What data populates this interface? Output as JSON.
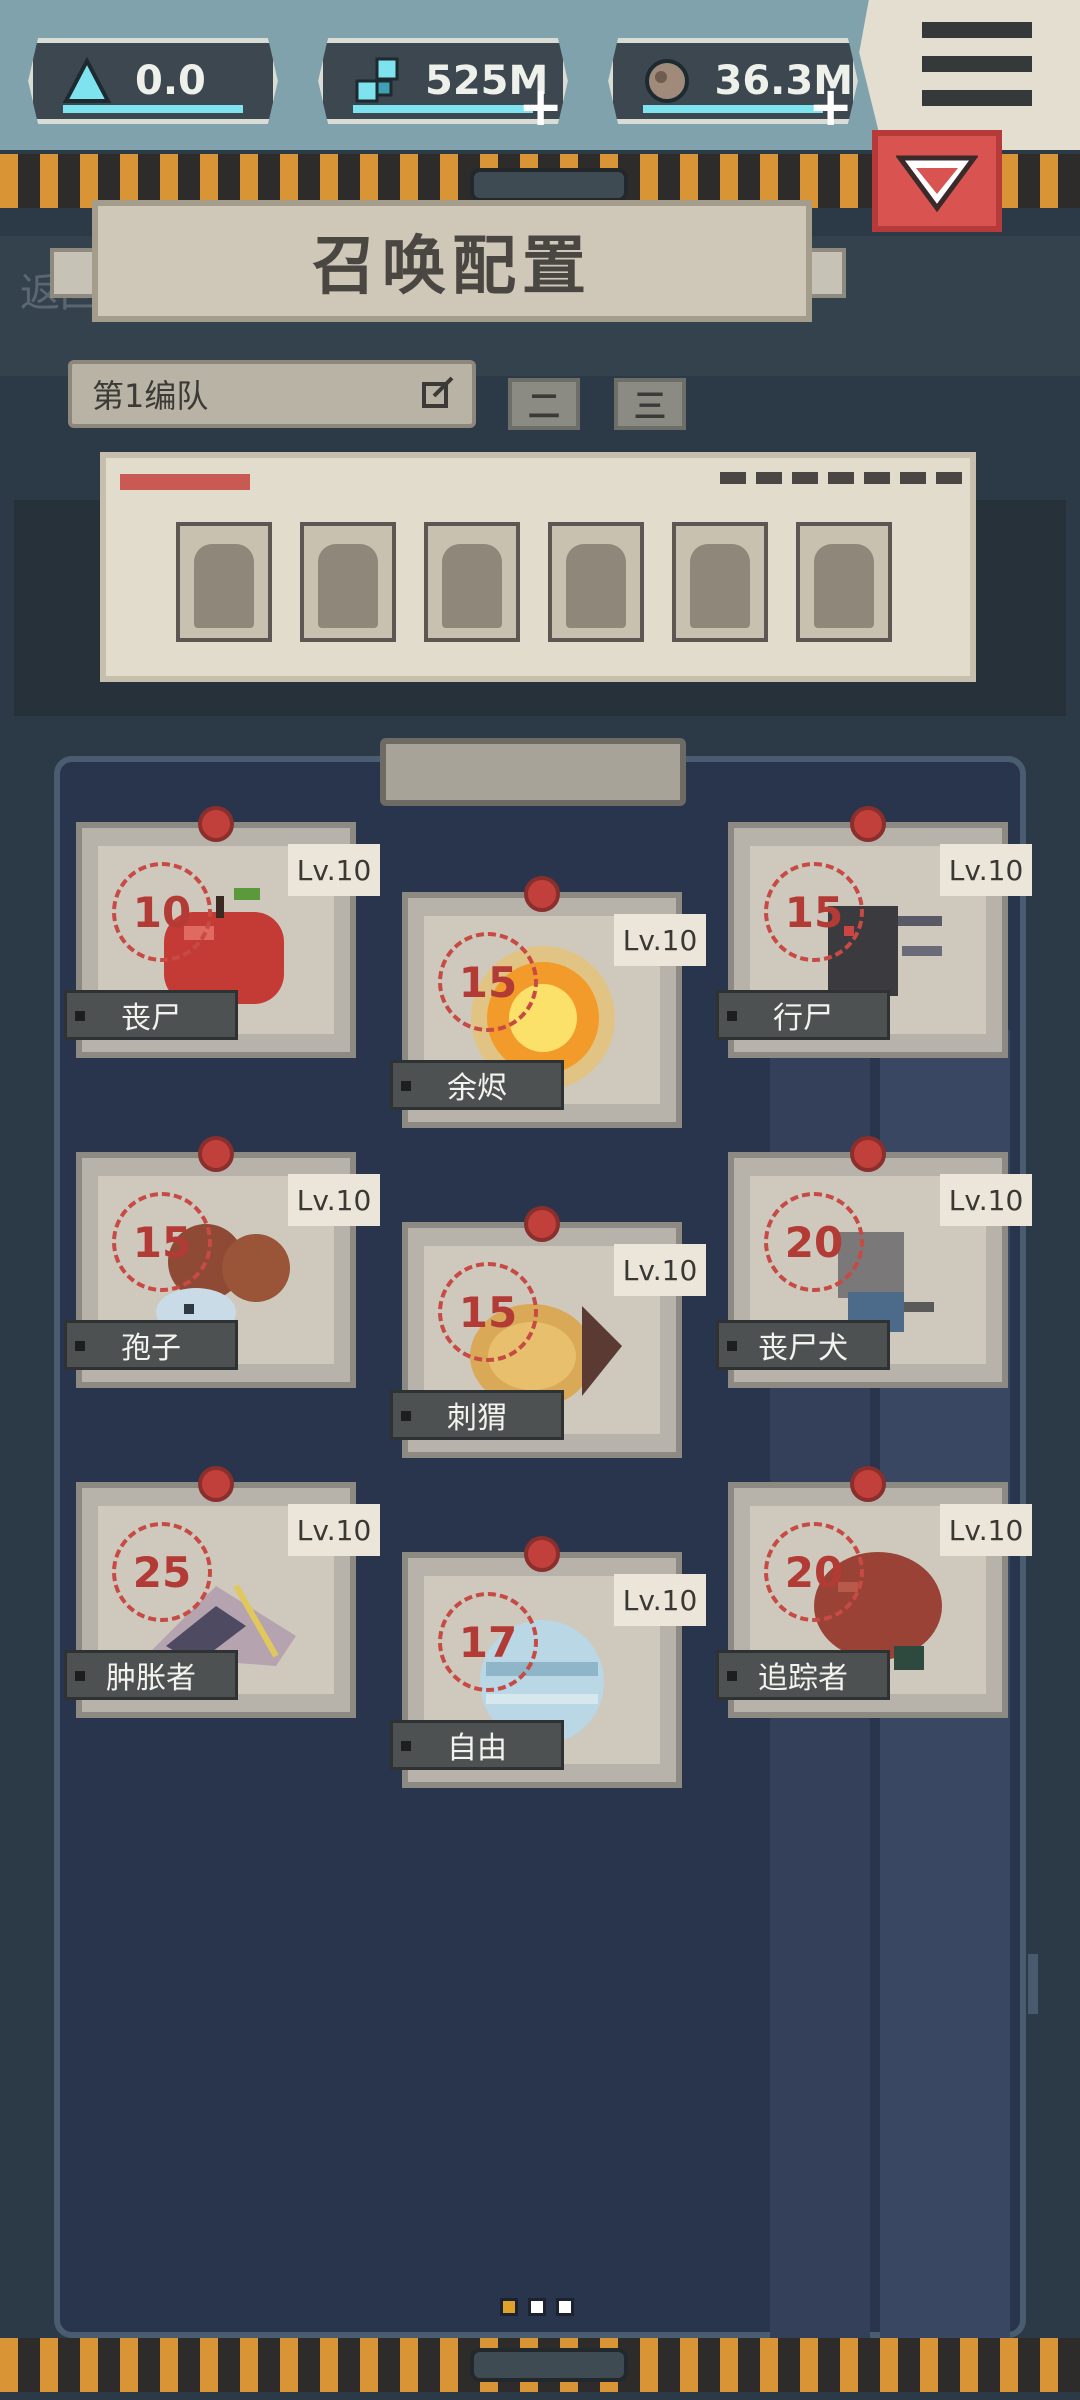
{
  "resources": [
    {
      "name": "triangle-currency",
      "value": "0.0",
      "icon": "triangle-icon"
    },
    {
      "name": "cells-currency",
      "value": "525M",
      "icon": "cells-icon"
    },
    {
      "name": "orb-currency",
      "value": "36.3M",
      "icon": "orb-icon"
    }
  ],
  "plus_label": "+",
  "page_title": "召唤配置",
  "back_label": "返回",
  "squad": {
    "selected": "第1编队",
    "tabs": [
      "二",
      "三"
    ]
  },
  "cards": [
    {
      "name": "丧尸",
      "cost": "10",
      "level": "Lv.10"
    },
    {
      "name": "余烬",
      "cost": "15",
      "level": "Lv.10"
    },
    {
      "name": "行尸",
      "cost": "15",
      "level": "Lv.10"
    },
    {
      "name": "孢子",
      "cost": "15",
      "level": "Lv.10"
    },
    {
      "name": "刺猬",
      "cost": "15",
      "level": "Lv.10"
    },
    {
      "name": "丧尸犬",
      "cost": "20",
      "level": "Lv.10"
    },
    {
      "name": "肿胀者",
      "cost": "25",
      "level": "Lv.10"
    },
    {
      "name": "自由",
      "cost": "17",
      "level": "Lv.10"
    },
    {
      "name": "追踪者",
      "cost": "20",
      "level": "Lv.10"
    }
  ],
  "colors": {
    "accent_red": "#d95350",
    "stripe_orange": "#d99436",
    "cyan": "#7ee3ee",
    "cost_red": "#b23b36"
  }
}
